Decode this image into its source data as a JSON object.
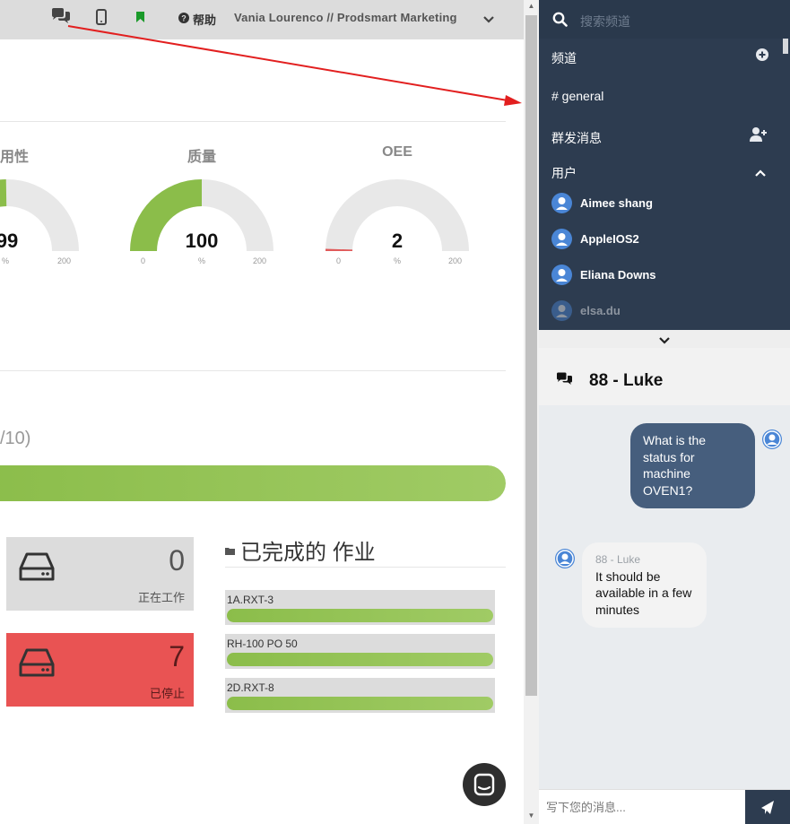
{
  "topbar": {
    "help_label": "帮助",
    "user_label": "Vania Lourenco // Prodsmart Marketing",
    "icons": [
      "chat-icon",
      "mobile-icon",
      "bookmark-icon",
      "help-icon",
      "chevron-down-icon"
    ]
  },
  "gauges": [
    {
      "title": "用性",
      "value": "99",
      "min": "0",
      "unit": "%",
      "max": "200",
      "fill_fraction": 0.495,
      "color": "#8bbd4a"
    },
    {
      "title": "质量",
      "value": "100",
      "min": "0",
      "unit": "%",
      "max": "200",
      "fill_fraction": 0.5,
      "color": "#8bbd4a"
    },
    {
      "title": "OEE",
      "value": "2",
      "min": "0",
      "unit": "%",
      "max": "200",
      "fill_fraction": 0.01,
      "color": "#e05a5a"
    }
  ],
  "progress": {
    "label": "/10)",
    "fill_percent": 100
  },
  "stats": [
    {
      "value": "0",
      "label": "正在工作"
    },
    {
      "value": "7",
      "label": "已停止"
    }
  ],
  "completed_jobs": {
    "title": "已完成的 作业",
    "items": [
      {
        "name": "1A.RXT-3",
        "progress": 100
      },
      {
        "name": "RH-100 PO 50",
        "progress": 100
      },
      {
        "name": "2D.RXT-8",
        "progress": 100
      }
    ]
  },
  "sidebar": {
    "search_placeholder": "搜索频道",
    "channels_label": "频道",
    "channel_general": "# general",
    "broadcast_label": "群发消息",
    "users_label": "用户",
    "users": [
      "Aimee shang",
      "AppleIOS2",
      "Eliana Downs",
      "elsa.du"
    ]
  },
  "chat": {
    "title": "88 - Luke",
    "messages": [
      {
        "direction": "out",
        "text": "What is the status for machine OVEN1?"
      },
      {
        "direction": "in",
        "sender": "88 - Luke",
        "text": "It should be available in a few minutes"
      }
    ],
    "composer_placeholder": "写下您的消息..."
  },
  "colors": {
    "accent_green": "#8bbd4a",
    "alert_red": "#e95353",
    "sidebar_bg": "#2d3c50",
    "outgoing_bubble": "#465e7d",
    "avatar_blue": "#4a86d6"
  }
}
